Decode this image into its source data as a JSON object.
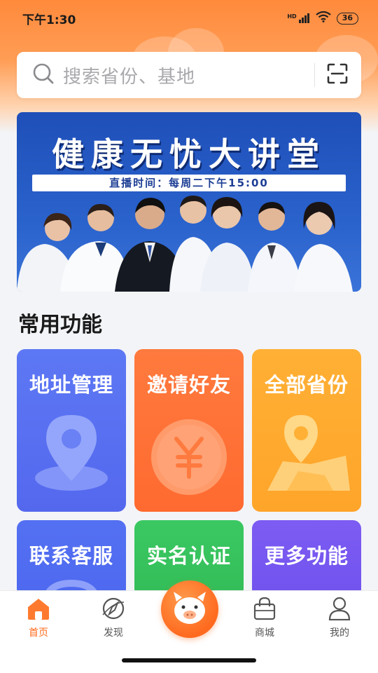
{
  "status_bar": {
    "time": "下午1:30",
    "signal_label": "HD",
    "battery": "36"
  },
  "search": {
    "placeholder": "搜索省份、基地"
  },
  "banner": {
    "title": "健康无忧大讲堂",
    "subtitle": "直播时间：每周二下午15:00"
  },
  "section": {
    "title": "常用功能"
  },
  "tiles": [
    {
      "label": "地址管理",
      "icon": "location-pin-icon",
      "color": "#5b73f2"
    },
    {
      "label": "邀请好友",
      "icon": "yen-coin-icon",
      "color": "#ff7438"
    },
    {
      "label": "全部省份",
      "icon": "map-pin-icon",
      "color": "#ffab2f"
    },
    {
      "label": "联系客服",
      "icon": "headset-icon",
      "color": "#4f6ff2"
    },
    {
      "label": "实名认证",
      "icon": "id-check-icon",
      "color": "#37c35c"
    },
    {
      "label": "更多功能",
      "icon": "more-icon",
      "color": "#7857f0"
    }
  ],
  "tabbar": {
    "items": [
      {
        "label": "首页",
        "icon": "home-icon",
        "active": true
      },
      {
        "label": "发现",
        "icon": "compass-icon",
        "active": false
      },
      {
        "label": "",
        "icon": "pig-mascot-icon",
        "active": false
      },
      {
        "label": "商城",
        "icon": "shopping-bag-icon",
        "active": false
      },
      {
        "label": "我的",
        "icon": "user-icon",
        "active": false
      }
    ]
  },
  "colors": {
    "accent": "#ff6a1a",
    "banner_blue": "#1f4fb8"
  }
}
